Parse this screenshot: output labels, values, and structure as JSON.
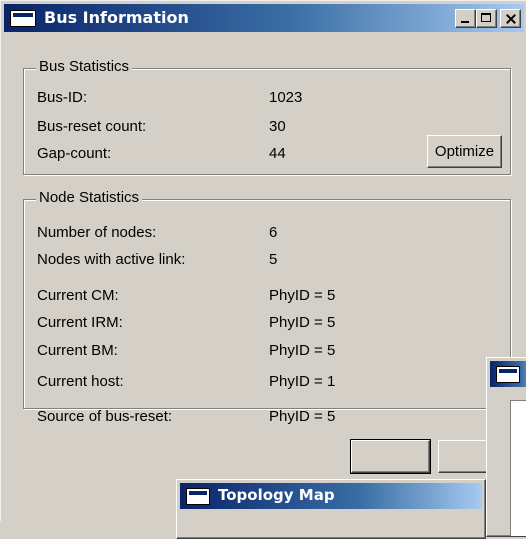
{
  "window": {
    "title": "Bus Information"
  },
  "bus_statistics": {
    "legend": "Bus Statistics",
    "bus_id_label": "Bus-ID:",
    "bus_id_value": "1023",
    "reset_count_label": "Bus-reset count:",
    "reset_count_value": "30",
    "gap_count_label": "Gap-count:",
    "gap_count_value": "44",
    "optimize_button": "Optimize"
  },
  "node_statistics": {
    "legend": "Node Statistics",
    "rows": [
      {
        "label": "Number of nodes:",
        "value": "6"
      },
      {
        "label": "Nodes with active link:",
        "value": "5"
      },
      {
        "label": "Current CM:",
        "value": "PhyID = 5"
      },
      {
        "label": "Current IRM:",
        "value": "PhyID = 5"
      },
      {
        "label": "Current BM:",
        "value": "PhyID = 5"
      },
      {
        "label": "Current host:",
        "value": "PhyID = 1"
      },
      {
        "label": "Source of bus-reset:",
        "value": "PhyID = 5"
      }
    ]
  },
  "topology_window": {
    "title": "Topology Map"
  }
}
